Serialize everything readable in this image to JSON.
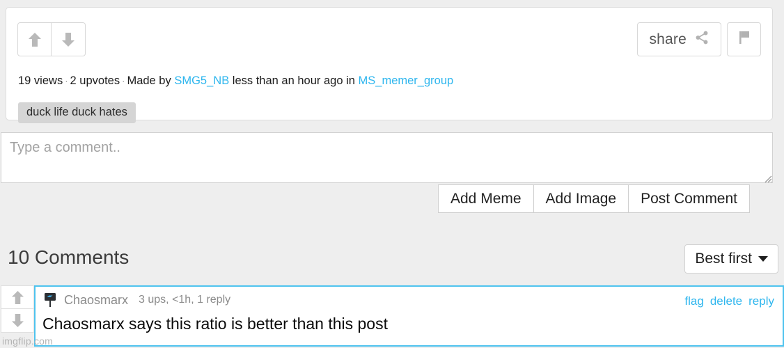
{
  "post": {
    "upvote_icon": "arrow-up-icon",
    "downvote_icon": "arrow-down-icon",
    "share_label": "share",
    "share_icon": "share-icon",
    "flag_icon": "flag-icon",
    "views": "19 views",
    "separator": "·",
    "upvotes": "2 upvotes",
    "made_by_prefix": "Made by",
    "author": "SMG5_NB",
    "time_ago": "less than an hour ago in",
    "stream": "MS_memer_group",
    "tag": "duck life duck hates",
    "link_color": "#2eb6ee"
  },
  "composer": {
    "placeholder": "Type a comment..",
    "value": "",
    "add_meme_label": "Add Meme",
    "add_image_label": "Add Image",
    "post_comment_label": "Post Comment",
    "resize_grip_icon": "resize-grip-icon"
  },
  "comments_section": {
    "heading": "10 Comments",
    "sort_label": "Best first",
    "sort_caret_icon": "chevron-down-icon"
  },
  "comments": [
    {
      "avatar_icon": "user-avatar-icon",
      "author": "Chaosmarx",
      "stats": "3 ups, <1h, 1 reply",
      "text": "Chaosmarx says this ratio is better than this post",
      "flag_label": "flag",
      "delete_label": "delete",
      "reply_label": "reply",
      "upvote_icon": "arrow-up-icon",
      "downvote_icon": "arrow-down-icon",
      "highlight_color": "#4ec3ee"
    }
  ],
  "watermark": "imgflip.com"
}
